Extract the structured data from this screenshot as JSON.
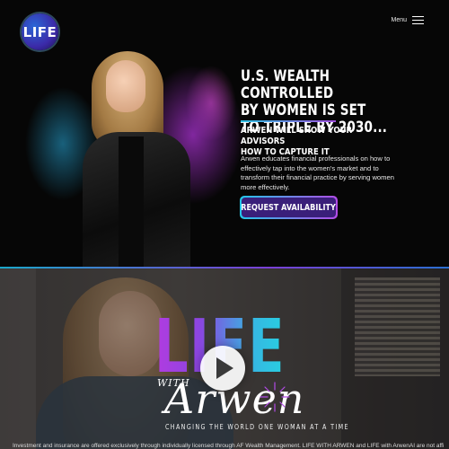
{
  "header": {
    "logo_text": "LIFE",
    "menu_label": "Menu"
  },
  "hero": {
    "headline": "U.S. WEALTH CONTROLLED\nBY WOMEN IS SET\nTO TRIPLE BY 2030...",
    "subhead": "ARWEN WILL SHOW YOUR ADVISORS\nHOW TO CAPTURE IT",
    "description": "Arwen educates financial professionals on how to effectively tap into the women's market and to transform their financial practice by serving women more effectively.",
    "cta_label": "REQUEST AVAILABILITY",
    "accent_cyan": "#2ec5e6",
    "accent_purple": "#a24fe0"
  },
  "video": {
    "title_big": "LIFE",
    "title_with": "WITH",
    "title_name": "Arwen",
    "tagline": "CHANGING THE WORLD ONE WOMAN AT A TIME",
    "disclaimer": "Investment and insurance are offered exclusively through individually licensed through AF Wealth Management. LIFE WITH ARWEN and LIFE with ArwenAI are not affiliated entities."
  }
}
